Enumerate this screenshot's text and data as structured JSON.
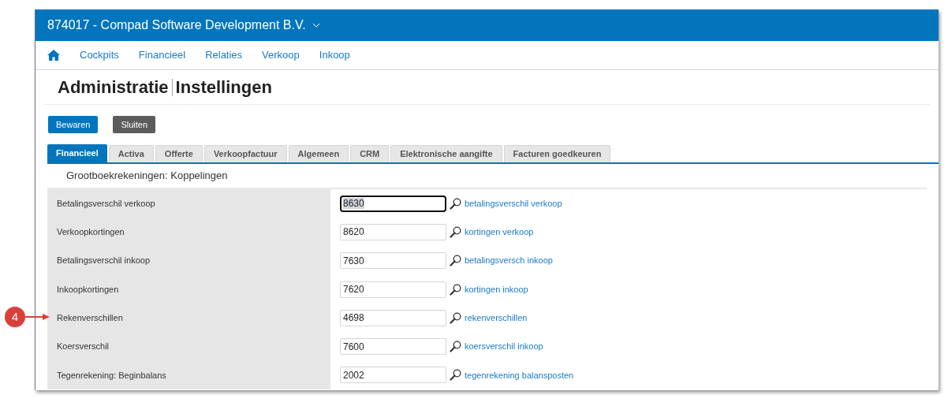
{
  "header": {
    "title": "874017 - Compad Software Development B.V."
  },
  "nav": {
    "items": [
      {
        "label": "Cockpits"
      },
      {
        "label": "Financieel"
      },
      {
        "label": "Relaties"
      },
      {
        "label": "Verkoop"
      },
      {
        "label": "Inkoop"
      }
    ]
  },
  "page_title": {
    "part_1": "Administratie",
    "part_2": "Instellingen"
  },
  "buttons": [
    {
      "label": "Bewaren",
      "kind": "primary"
    },
    {
      "label": "Sluiten",
      "kind": "secondary"
    }
  ],
  "tabs": [
    {
      "label": "Financieel",
      "selected": true
    },
    {
      "label": "Activa",
      "selected": false
    },
    {
      "label": "Offerte",
      "selected": false
    },
    {
      "label": "Verkoopfactuur",
      "selected": false
    },
    {
      "label": "Algemeen",
      "selected": false
    },
    {
      "label": "CRM",
      "selected": false
    },
    {
      "label": "Elektronische aangifte",
      "selected": false
    },
    {
      "label": "Facturen goedkeuren",
      "selected": false
    }
  ],
  "section_title": "Grootboekrekeningen: Koppelingen",
  "rows": [
    {
      "label": "Betalingsverschil verkoop",
      "value": "8630",
      "focused": true,
      "link": "betalingsverschil verkoop"
    },
    {
      "label": "Verkoopkortingen",
      "value": "8620",
      "focused": false,
      "link": "kortingen verkoop"
    },
    {
      "label": "Betalingsverschil inkoop",
      "value": "7630",
      "focused": false,
      "link": "betalingsversch inkoop"
    },
    {
      "label": "Inkoopkortingen",
      "value": "7620",
      "focused": false,
      "link": "kortingen inkoop"
    },
    {
      "label": "Rekenverschillen",
      "value": "4698",
      "focused": false,
      "link": "rekenverschillen",
      "callout": "4"
    },
    {
      "label": "Koersverschil",
      "value": "7600",
      "focused": false,
      "link": "koersverschil inkoop"
    },
    {
      "label": "Tegenrekening: Beginbalans",
      "value": "2002",
      "focused": false,
      "link": "tegenrekening balansposten"
    }
  ]
}
